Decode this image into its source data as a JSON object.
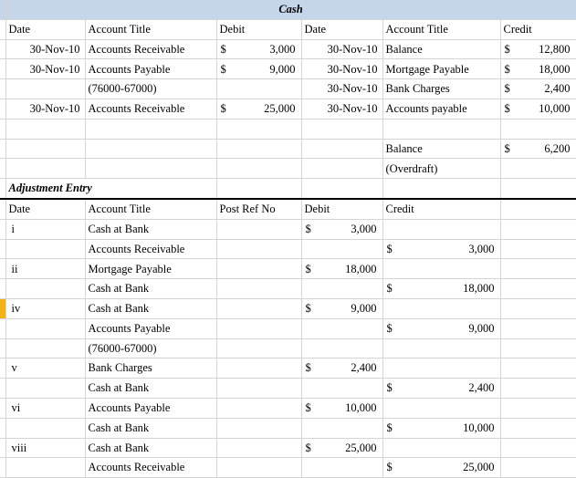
{
  "document": {
    "title": "Cash",
    "title_band_color": "#c6d6ea",
    "marker_color": "#f5b216"
  },
  "cash_ledger": {
    "headers": {
      "debit_side": {
        "date": "Date",
        "account_title": "Account Title",
        "amount": "Debit"
      },
      "credit_side": {
        "date": "Date",
        "account_title": "Account Title",
        "amount": "Credit"
      }
    },
    "debit_rows": [
      {
        "date": "30-Nov-10",
        "account": "Accounts Receivable",
        "currency": "$",
        "amount": "3,000"
      },
      {
        "date": "30-Nov-10",
        "account": "Accounts Payable",
        "currency": "$",
        "amount": "9,000"
      },
      {
        "date": "",
        "account": "(76000-67000)",
        "currency": "",
        "amount": ""
      },
      {
        "date": "30-Nov-10",
        "account": "Accounts Receivable",
        "currency": "$",
        "amount": "25,000"
      },
      {
        "date": "",
        "account": "",
        "currency": "",
        "amount": ""
      }
    ],
    "credit_rows": [
      {
        "date": "30-Nov-10",
        "account": "Balance",
        "currency": "$",
        "amount": "12,800"
      },
      {
        "date": "30-Nov-10",
        "account": "Mortgage Payable",
        "currency": "$",
        "amount": "18,000"
      },
      {
        "date": "30-Nov-10",
        "account": "Bank Charges",
        "currency": "$",
        "amount": "2,400"
      },
      {
        "date": "30-Nov-10",
        "account": "Accounts payable",
        "currency": "$",
        "amount": "10,000"
      },
      {
        "date": "",
        "account": "",
        "currency": "",
        "amount": ""
      }
    ],
    "balance_rows": [
      {
        "date": "",
        "account": "Balance",
        "currency": "$",
        "amount": "6,200"
      },
      {
        "date": "",
        "account": "(Overdraft)",
        "currency": "",
        "amount": ""
      }
    ]
  },
  "adjustment_entry": {
    "section_label": "Adjustment Entry",
    "headers": {
      "date": "Date",
      "account_title": "Account Title",
      "post_ref_no": "Post Ref No",
      "debit": "Debit",
      "credit": "Credit"
    },
    "rows": [
      {
        "ref": "i",
        "account": "Cash at Bank",
        "debit_cur": "$",
        "debit": "3,000",
        "credit_cur": "",
        "credit": "",
        "selected": false
      },
      {
        "ref": "",
        "account": "Accounts Receivable",
        "debit_cur": "",
        "debit": "",
        "credit_cur": "$",
        "credit": "3,000",
        "selected": false
      },
      {
        "ref": "ii",
        "account": "Mortgage Payable",
        "debit_cur": "$",
        "debit": "18,000",
        "credit_cur": "",
        "credit": "",
        "selected": false
      },
      {
        "ref": "",
        "account": "Cash at Bank",
        "debit_cur": "",
        "debit": "",
        "credit_cur": "$",
        "credit": "18,000",
        "selected": false
      },
      {
        "ref": "iv",
        "account": "Cash at Bank",
        "debit_cur": "$",
        "debit": "9,000",
        "credit_cur": "",
        "credit": "",
        "selected": true
      },
      {
        "ref": "",
        "account": "Accounts Payable",
        "debit_cur": "",
        "debit": "",
        "credit_cur": "$",
        "credit": "9,000",
        "selected": false
      },
      {
        "ref": "",
        "account": "(76000-67000)",
        "debit_cur": "",
        "debit": "",
        "credit_cur": "",
        "credit": "",
        "selected": false
      },
      {
        "ref": "v",
        "account": "Bank Charges",
        "debit_cur": "$",
        "debit": "2,400",
        "credit_cur": "",
        "credit": "",
        "selected": false
      },
      {
        "ref": "",
        "account": "Cash at Bank",
        "debit_cur": "",
        "debit": "",
        "credit_cur": "$",
        "credit": "2,400",
        "selected": false
      },
      {
        "ref": "vi",
        "account": "Accounts Payable",
        "debit_cur": "$",
        "debit": "10,000",
        "credit_cur": "",
        "credit": "",
        "selected": false
      },
      {
        "ref": "",
        "account": "Cash at Bank",
        "debit_cur": "",
        "debit": "",
        "credit_cur": "$",
        "credit": "10,000",
        "selected": false
      },
      {
        "ref": "viii",
        "account": "Cash at Bank",
        "debit_cur": "$",
        "debit": "25,000",
        "credit_cur": "",
        "credit": "",
        "selected": false
      },
      {
        "ref": "",
        "account": "Accounts Receivable",
        "debit_cur": "",
        "debit": "",
        "credit_cur": "$",
        "credit": "25,000",
        "selected": false
      }
    ]
  }
}
